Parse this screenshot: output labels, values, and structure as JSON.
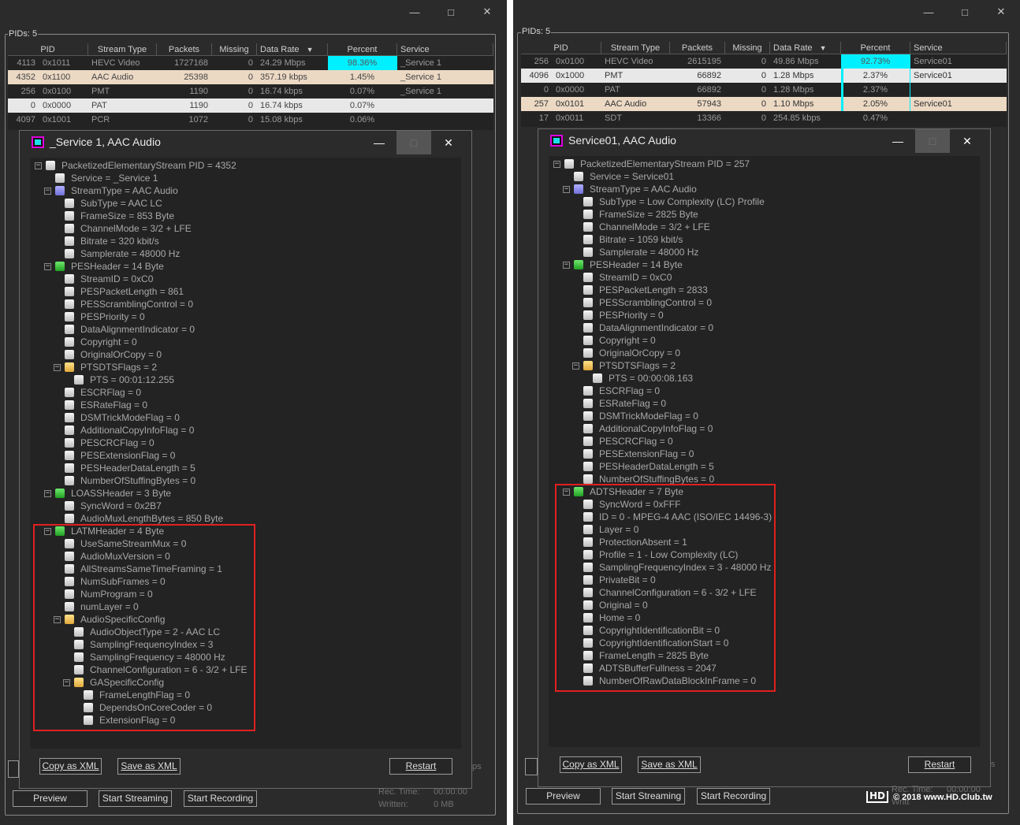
{
  "left": {
    "group_label": "PIDs: 5",
    "columns": [
      "PID",
      "Stream Type",
      "Packets",
      "Missing",
      "Data Rate",
      "Percent",
      "Service"
    ],
    "rows": [
      {
        "pid": "4113",
        "hex": "0x1011",
        "type": "HEVC Video",
        "packets": "1727168",
        "missing": "0",
        "rate": "24.29 Mbps",
        "percent": "98.36%",
        "service": "_Service 1"
      },
      {
        "pid": "4352",
        "hex": "0x1100",
        "type": "AAC Audio",
        "packets": "25398",
        "missing": "0",
        "rate": "357.19 kbps",
        "percent": "1.45%",
        "service": "_Service 1"
      },
      {
        "pid": "256",
        "hex": "0x0100",
        "type": "PMT",
        "packets": "1190",
        "missing": "0",
        "rate": "16.74 kbps",
        "percent": "0.07%",
        "service": "_Service 1"
      },
      {
        "pid": "0",
        "hex": "0x0000",
        "type": "PAT",
        "packets": "1190",
        "missing": "0",
        "rate": "16.74 kbps",
        "percent": "0.07%",
        "service": ""
      },
      {
        "pid": "4097",
        "hex": "0x1001",
        "type": "PCR",
        "packets": "1072",
        "missing": "0",
        "rate": "15.08 kbps",
        "percent": "0.06%",
        "service": ""
      }
    ],
    "dialog_title": "_Service 1, AAC Audio",
    "tree": [
      "PacketizedElementaryStream PID = 4352",
      "Service = _Service 1",
      "StreamType = AAC Audio",
      "SubType = AAC LC",
      "FrameSize = 853 Byte",
      "ChannelMode = 3/2 + LFE",
      "Bitrate = 320 kbit/s",
      "Samplerate = 48000 Hz",
      "PESHeader = 14 Byte",
      "StreamID = 0xC0",
      "PESPacketLength = 861",
      "PESScramblingControl = 0",
      "PESPriority = 0",
      "DataAlignmentIndicator = 0",
      "Copyright = 0",
      "OriginalOrCopy = 0",
      "PTSDTSFlags = 2",
      "PTS = 00:01:12.255",
      "ESCRFlag = 0",
      "ESRateFlag = 0",
      "DSMTrickModeFlag = 0",
      "AdditionalCopyInfoFlag = 0",
      "PESCRCFlag = 0",
      "PESExtensionFlag = 0",
      "PESHeaderDataLength = 5",
      "NumberOfStuffingBytes = 0",
      "LOASSHeader = 3 Byte",
      "SyncWord = 0x2B7",
      "AudioMuxLengthBytes = 850 Byte",
      "LATMHeader = 4 Byte",
      "UseSameStreamMux = 0",
      "AudioMuxVersion = 0",
      "AllStreamsSameTimeFraming = 1",
      "NumSubFrames = 0",
      "NumProgram = 0",
      "numLayer = 0",
      "AudioSpecificConfig",
      "AudioObjectType = 2 - AAC LC",
      "SamplingFrequencyIndex = 3",
      "SamplingFrequency = 48000 Hz",
      "ChannelConfiguration = 6 - 3/2 + LFE",
      "GASpecificConfig",
      "FrameLengthFlag = 0",
      "DependsOnCoreCoder = 0",
      "ExtensionFlag = 0"
    ],
    "copy_xml": "Copy as XML",
    "save_xml": "Save as XML",
    "restart": "Restart",
    "preview": "Preview",
    "start_streaming": "Start Streaming",
    "start_recording": "Start Recording",
    "rec_time_label": "Rec. Time:",
    "rec_time_value": "00:00:00",
    "written_label": "Written:",
    "written_value": "0 MB",
    "ps_fragment": "ps"
  },
  "right": {
    "group_label": "PIDs: 5",
    "columns": [
      "PID",
      "Stream Type",
      "Packets",
      "Missing",
      "Data Rate",
      "Percent",
      "Service"
    ],
    "rows": [
      {
        "pid": "256",
        "hex": "0x0100",
        "type": "HEVC Video",
        "packets": "2615195",
        "missing": "0",
        "rate": "49.86 Mbps",
        "percent": "92.73%",
        "service": "Service01"
      },
      {
        "pid": "4096",
        "hex": "0x1000",
        "type": "PMT",
        "packets": "66892",
        "missing": "0",
        "rate": "1.28 Mbps",
        "percent": "2.37%",
        "service": "Service01"
      },
      {
        "pid": "0",
        "hex": "0x0000",
        "type": "PAT",
        "packets": "66892",
        "missing": "0",
        "rate": "1.28 Mbps",
        "percent": "2.37%",
        "service": ""
      },
      {
        "pid": "257",
        "hex": "0x0101",
        "type": "AAC Audio",
        "packets": "57943",
        "missing": "0",
        "rate": "1.10 Mbps",
        "percent": "2.05%",
        "service": "Service01"
      },
      {
        "pid": "17",
        "hex": "0x0011",
        "type": "SDT",
        "packets": "13366",
        "missing": "0",
        "rate": "254.85 kbps",
        "percent": "0.47%",
        "service": ""
      }
    ],
    "dialog_title": "Service01, AAC Audio",
    "tree": [
      "PacketizedElementaryStream PID = 257",
      "Service = Service01",
      "StreamType = AAC Audio",
      "SubType = Low Complexity (LC) Profile",
      "FrameSize = 2825 Byte",
      "ChannelMode = 3/2 + LFE",
      "Bitrate = 1059 kbit/s",
      "Samplerate = 48000 Hz",
      "PESHeader = 14 Byte",
      "StreamID = 0xC0",
      "PESPacketLength = 2833",
      "PESScramblingControl = 0",
      "PESPriority = 0",
      "DataAlignmentIndicator = 0",
      "Copyright = 0",
      "OriginalOrCopy = 0",
      "PTSDTSFlags = 2",
      "PTS = 00:00:08.163",
      "ESCRFlag = 0",
      "ESRateFlag = 0",
      "DSMTrickModeFlag = 0",
      "AdditionalCopyInfoFlag = 0",
      "PESCRCFlag = 0",
      "PESExtensionFlag = 0",
      "PESHeaderDataLength = 5",
      "NumberOfStuffingBytes = 0",
      "ADTSHeader = 7 Byte",
      "SyncWord = 0xFFF",
      "ID = 0 - MPEG-4 AAC (ISO/IEC 14496-3)",
      "Layer = 0",
      "ProtectionAbsent = 1",
      "Profile = 1 - Low Complexity (LC)",
      "SamplingFrequencyIndex = 3 - 48000 Hz",
      "PrivateBit = 0",
      "ChannelConfiguration = 6 - 3/2 + LFE",
      "Original = 0",
      "Home = 0",
      "CopyrightIdentificationBit = 0",
      "CopyrightIdentificationStart = 0",
      "FrameLength = 2825 Byte",
      "ADTSBufferFullness = 2047",
      "NumberOfRawDataBlockInFrame = 0"
    ],
    "copy_xml": "Copy as XML",
    "save_xml": "Save as XML",
    "restart": "Restart",
    "preview": "Preview",
    "start_streaming": "Start Streaming",
    "start_recording": "Start Recording",
    "rec_time_label": "Rec. Time:",
    "rec_time_value": "00:00:00",
    "written_fragment": "Writt",
    "ps_fragment": "s"
  },
  "watermark": {
    "logo": "HD CLUB",
    "text": "© 2018 www.HD.Club.tw"
  },
  "colors": {
    "cyan": "#00f0ff",
    "audio_row": "#ecd9c4",
    "white_row": "#e8e8e8",
    "red_box": "#e02020"
  },
  "icons": {
    "minimize": "minimize-icon",
    "maximize": "maximize-icon",
    "close": "close-icon"
  }
}
